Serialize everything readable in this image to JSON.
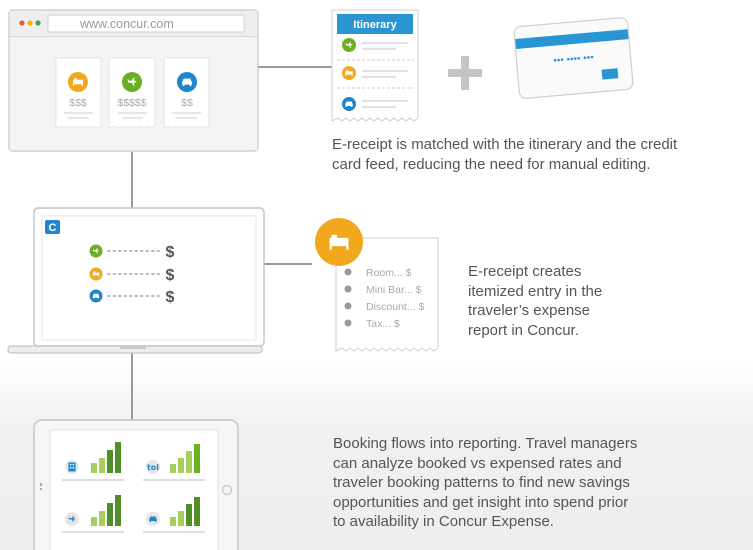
{
  "browser": {
    "url": "www.concur.com",
    "prices": [
      "$$$",
      "$$$$$",
      "$$"
    ]
  },
  "itinerary": {
    "title": "Itinerary"
  },
  "card": {
    "number_mask": "••• •••• •••"
  },
  "laptop": {
    "logo_letter": "C",
    "row_amount": "$"
  },
  "receipt": {
    "items": [
      "Room... $",
      "Mini Bar... $",
      "Discount... $",
      "Tax... $"
    ]
  },
  "captions": {
    "matched": "E-receipt is matched with the itinerary and the credit\ncard feed, reducing the need for manual editing.",
    "itemized": "E-receipt creates\nitemized entry in the\ntraveler’s expense\nreport in Concur.",
    "reporting": "Booking flows into reporting. Travel managers\ncan analyze booked vs expensed rates and\ntraveler booking patterns to find new savings\nopportunities and get insight into spend prior\nto availability in Concur Expense."
  },
  "icons": {
    "hotel": "bed-icon",
    "flight": "plane-icon",
    "car": "car-icon",
    "dining": "fork-knife-icon",
    "building": "building-icon"
  },
  "colors": {
    "hotel": "#f2a81d",
    "flight": "#6ab023",
    "car": "#1f87c9",
    "bar_light": "#a6d05b",
    "bar_dark": "#4f8f2a",
    "connector": "#9a9a9a",
    "card_stripe": "#2a95d4"
  }
}
